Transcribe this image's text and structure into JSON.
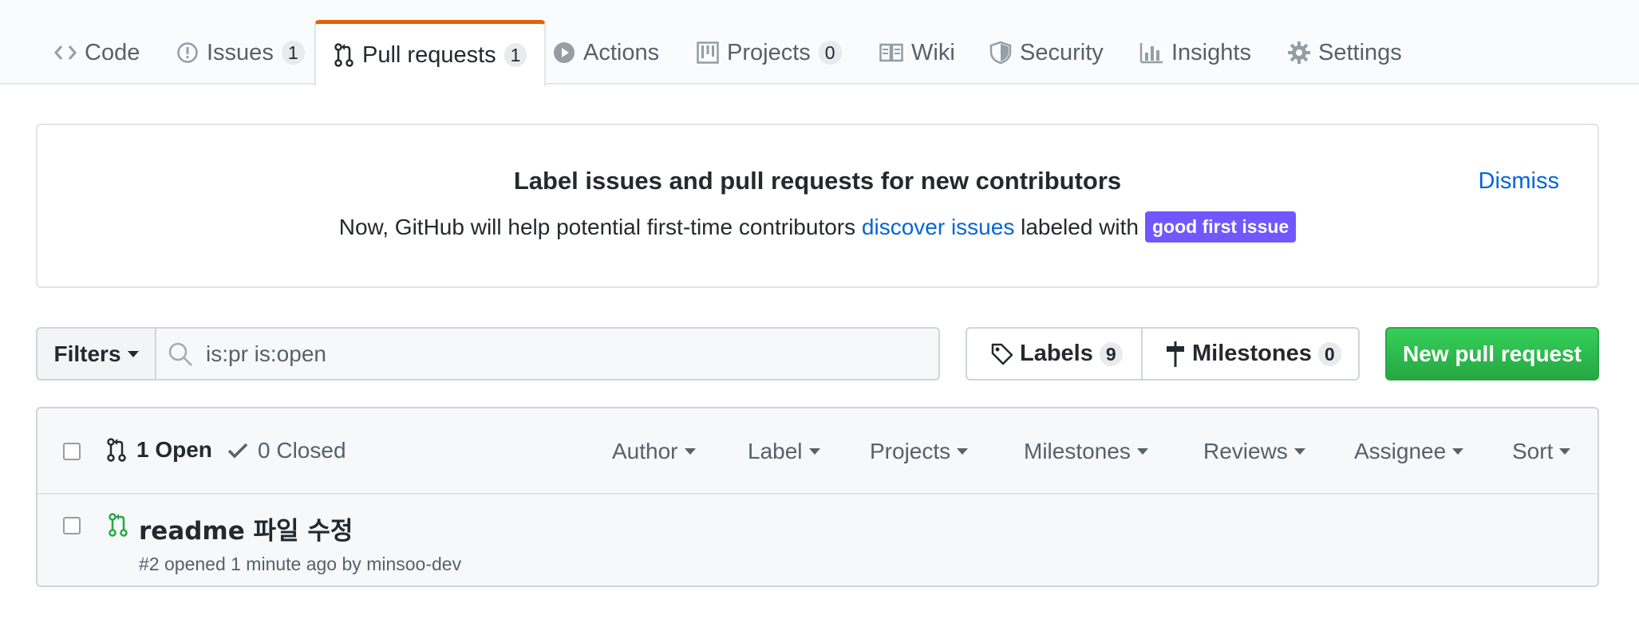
{
  "tabs": [
    {
      "label": "Code",
      "icon": "code-icon"
    },
    {
      "label": "Issues",
      "icon": "issue-opened-icon",
      "count": "1"
    },
    {
      "label": "Pull requests",
      "icon": "git-pull-request-icon",
      "count": "1",
      "selected": true
    },
    {
      "label": "Actions",
      "icon": "play-icon"
    },
    {
      "label": "Projects",
      "icon": "project-icon",
      "count": "0"
    },
    {
      "label": "Wiki",
      "icon": "book-icon"
    },
    {
      "label": "Security",
      "icon": "shield-icon"
    },
    {
      "label": "Insights",
      "icon": "graph-icon"
    },
    {
      "label": "Settings",
      "icon": "gear-icon"
    }
  ],
  "banner": {
    "title": "Label issues and pull requests for new contributors",
    "text_before": "Now, GitHub will help potential first-time contributors ",
    "link": "discover issues",
    "text_after": " labeled with",
    "label": "good first issue",
    "label_color": "#7057ff",
    "dismiss": "Dismiss"
  },
  "filters": {
    "button": "Filters",
    "search_value": "is:pr is:open",
    "labels": "Labels",
    "labels_count": "9",
    "milestones": "Milestones",
    "milestones_count": "0",
    "new_button": "New pull request"
  },
  "list": {
    "open": "1 Open",
    "closed": "0 Closed",
    "header_filters": [
      "Author",
      "Label",
      "Projects",
      "Milestones",
      "Reviews",
      "Assignee",
      "Sort"
    ],
    "items": [
      {
        "title": "readme 파일 수정",
        "number": "#2",
        "opened": "opened 1 minute ago by",
        "author": "minsoo-dev"
      }
    ]
  },
  "colors": {
    "accent_tab": "#e36209",
    "link": "#0366d6",
    "open_green": "#28a745"
  }
}
